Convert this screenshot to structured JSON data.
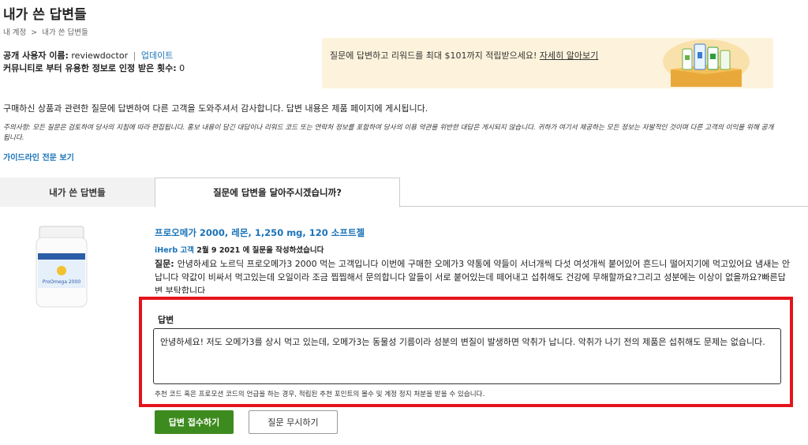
{
  "page": {
    "title": "내가 쓴 답변들",
    "breadcrumb": [
      "내 계정",
      ">",
      "내가 쓴 답변들"
    ]
  },
  "profile": {
    "public_name_label": "공개 사용자 이름:",
    "public_name_value": "reviewdoctor",
    "separator": "|",
    "update_link": "업데이트",
    "helpful_label": "커뮤니티로 부터 유용한 정보로 인정 받은 횟수:",
    "helpful_count": "0"
  },
  "promo": {
    "text": "질문에 답변하고 리워드를 최대 $101까지 적립받으세요!",
    "link": "자세히 알아보기"
  },
  "intro": "구매하신 상품과 관련한 질문에 답변하여 다른 고객을 도와주셔서 감사합니다. 답변 내용은 제품 페이지에 게시됩니다.",
  "notice": {
    "label": "주의사항:",
    "text": "모든 질문은 검토하여 당사의 지침에 따라 편집됩니다. 홍보 내용이 담긴 대답이나 리워드 코드 또는 연락처 정보를 포함하여 당사의 이용 약관을 위반한 대답은 게시되지 않습니다. 귀하가 여기서 제공하는 모든 정보는 자발적인 것이며 다른 고객의 이익을 위해 공개됩니다."
  },
  "guide_link": "가이드라인 전문 보기",
  "tabs": [
    {
      "label": "내가 쓴 답변들"
    },
    {
      "label": "질문에 답변을 달아주시겠습니까?"
    }
  ],
  "product": {
    "image_icon": "supplement-bottle-image",
    "image_text": "ProOmega 2000",
    "title": "프로오메가 2000, 레몬, 1,250 mg, 120 소프트젤",
    "asker_name": "iHerb 고객",
    "asker_date": "2월 9 2021 에 질문을 작성하셨습니다",
    "question_label": "질문:",
    "question_text": "안녕하세요 노르딕 프로오메가3 2000 먹는 고객입니다 이번에 구매한 오메가3 약통에 약들이 서너개씩 다섯 여섯개씩 붙어있어 흔드니 떨어지기에 먹고있어요 냄새는 안납니다 약값이 비싸서 먹고있는데 오일이라 조금 찝찝해서 문의합니다 알들이 서로 붙어있는데 떼어내고 섭취해도 건강에 무해할까요?그리고 성분에는 이상이 없을까요?빠른답변 부탁합니다"
  },
  "answer": {
    "label": "답변",
    "value": "안녕하세요! 저도 오메가3를 상시 먹고 있는데, 오메가3는 동물성 기름이라 성분의 변질이 발생하면 악취가 납니다. 악취가 나기 전의 제품은 섭취해도 문제는 없습니다.",
    "note": "추천 코드 혹은 프로모션 코드의 언급을 하는 경우, 적립된 추천 포인트의 몰수 및 계정 정지 처분을 받을 수 있습니다."
  },
  "buttons": {
    "submit": "답변 접수하기",
    "ignore": "질문 무시하기"
  },
  "colors": {
    "link": "#1a73b8",
    "highlight_border": "#e3141b",
    "submit_button": "#3d8b1e",
    "promo_bg": "#fdf3dc"
  }
}
